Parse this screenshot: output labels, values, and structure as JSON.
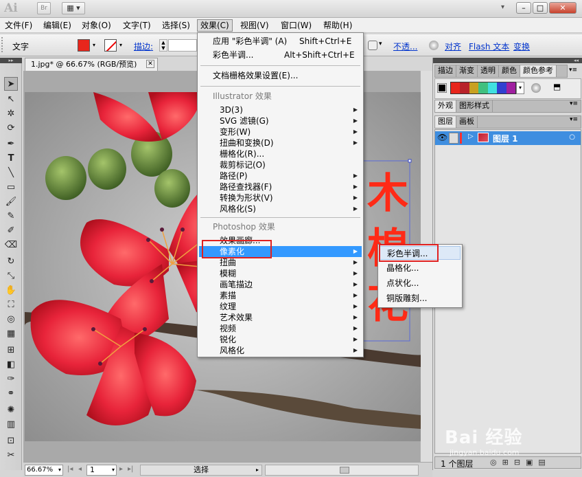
{
  "app": {
    "logo": "Ai",
    "bridge_label": "Br",
    "window_controls": [
      "–",
      "□",
      "✕"
    ]
  },
  "menubar": {
    "items": [
      "文件(F)",
      "编辑(E)",
      "对象(O)",
      "文字(T)",
      "选择(S)",
      "效果(C)",
      "视图(V)",
      "窗口(W)",
      "帮助(H)"
    ],
    "active": "效果(C)"
  },
  "control_bar": {
    "type_label": "文字",
    "stroke_label": "描边:",
    "links": [
      "不透...",
      "对齐",
      "Flash 文本",
      "变换"
    ],
    "fill_color": "#e8261c"
  },
  "document_tab": {
    "title": "1.jpg* @ 66.67% (RGB/预览)",
    "close": "✕"
  },
  "effect_menu": {
    "apply_last": {
      "label": "应用 \"彩色半调\" (A)",
      "shortcut": "Shift+Ctrl+E"
    },
    "last_effect": {
      "label": "彩色半调...",
      "shortcut": "Alt+Shift+Ctrl+E"
    },
    "raster_settings": "文档栅格效果设置(E)...",
    "illustrator_header": "Illustrator 效果",
    "illustrator_items": [
      {
        "label": "3D(3)",
        "submenu": true
      },
      {
        "label": "SVG 滤镜(G)",
        "submenu": true
      },
      {
        "label": "变形(W)",
        "submenu": true
      },
      {
        "label": "扭曲和变换(D)",
        "submenu": true
      },
      {
        "label": "栅格化(R)...",
        "submenu": false
      },
      {
        "label": "裁剪标记(O)",
        "submenu": false
      },
      {
        "label": "路径(P)",
        "submenu": true
      },
      {
        "label": "路径查找器(F)",
        "submenu": true
      },
      {
        "label": "转换为形状(V)",
        "submenu": true
      },
      {
        "label": "风格化(S)",
        "submenu": true
      }
    ],
    "photoshop_header": "Photoshop 效果",
    "photoshop_items": [
      {
        "label": "效果画廊...",
        "submenu": false
      },
      {
        "label": "像素化",
        "submenu": true
      },
      {
        "label": "扭曲",
        "submenu": true
      },
      {
        "label": "模糊",
        "submenu": true
      },
      {
        "label": "画笔描边",
        "submenu": true
      },
      {
        "label": "素描",
        "submenu": true
      },
      {
        "label": "纹理",
        "submenu": true
      },
      {
        "label": "艺术效果",
        "submenu": true
      },
      {
        "label": "视频",
        "submenu": true
      },
      {
        "label": "锐化",
        "submenu": true
      },
      {
        "label": "风格化",
        "submenu": true
      }
    ],
    "highlighted": "像素化"
  },
  "pixelate_submenu": {
    "items": [
      "彩色半调...",
      "晶格化...",
      "点状化...",
      "铜版雕刻..."
    ],
    "highlighted": "彩色半调..."
  },
  "panels": {
    "top_tabs": [
      "描边",
      "渐变",
      "透明",
      "颜色",
      "颜色参考"
    ],
    "top_active": "颜色参考",
    "swatches": [
      "#e8261c",
      "#b8222a",
      "#c8a020",
      "#40c080",
      "#40e0e0",
      "#3040d0",
      "#a020a0"
    ],
    "middle_tabs": [
      "外观",
      "图形样式"
    ],
    "middle_active": "外观",
    "layer_tabs": [
      "图层",
      "画板"
    ],
    "layer_active": "图层",
    "layer_name": "图层 1",
    "layer_count": "1 个图层"
  },
  "status_bar": {
    "zoom": "66.67%",
    "page": "1",
    "tool": "选择"
  },
  "canvas_text": [
    "木",
    "棉",
    "花"
  ],
  "watermark": {
    "brand": "Bai 经验",
    "url": "jingyan.baidu.com"
  }
}
